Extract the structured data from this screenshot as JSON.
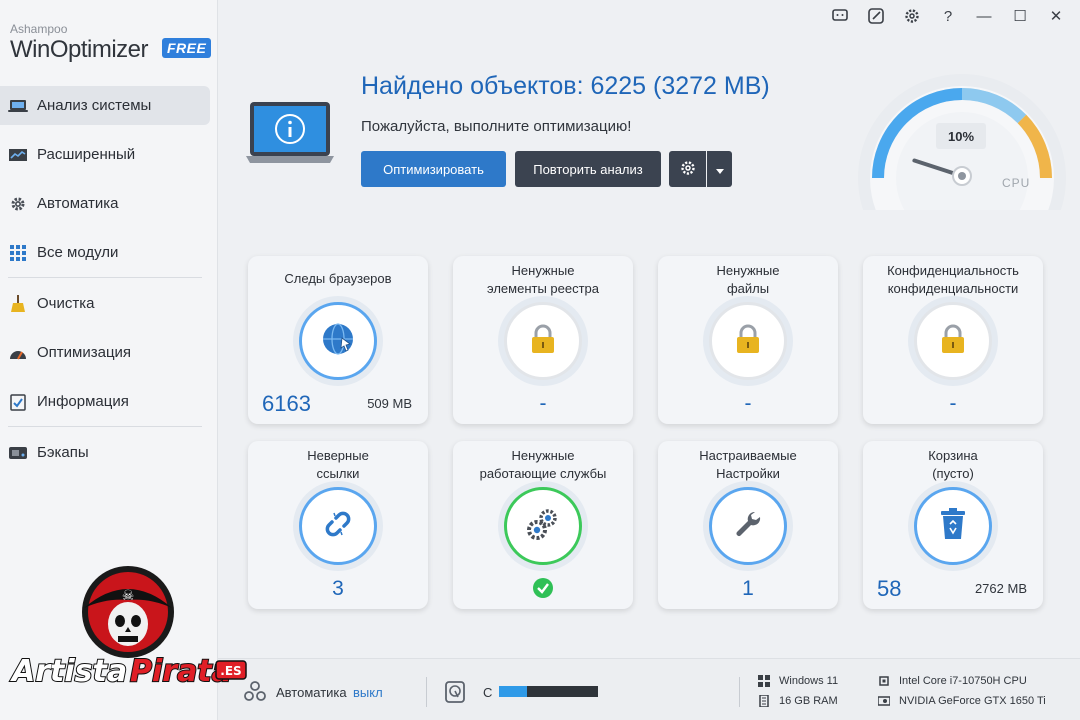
{
  "app": {
    "brand_small": "Ashampoo",
    "brand_name": "WinOptimizer",
    "edition": "FREE"
  },
  "window_controls": [
    "feedback-icon",
    "skin-icon",
    "settings-icon",
    "help-icon",
    "minimize-icon",
    "maximize-icon",
    "close-icon"
  ],
  "window_controls_glyphs": {
    "help": "?",
    "minimize": "—",
    "maximize": "☐",
    "close": "✕"
  },
  "sidebar": {
    "items": [
      {
        "label": "Анализ системы",
        "icon": "laptop-icon",
        "active": true
      },
      {
        "label": "Расширенный",
        "icon": "chart-icon"
      },
      {
        "label": "Автоматика",
        "icon": "cog-icon"
      },
      {
        "label": "Все модули",
        "icon": "grid-icon"
      },
      {
        "label": "Очистка",
        "icon": "broom-icon"
      },
      {
        "label": "Оптимизация",
        "icon": "speedometer-icon"
      },
      {
        "label": "Информация",
        "icon": "checklist-icon"
      },
      {
        "label": "Бэкапы",
        "icon": "drive-icon"
      }
    ]
  },
  "hero": {
    "title": "Найдено объектов: 6225 (3272 MB)",
    "subtitle": "Пожалуйста, выполните оптимизацию!",
    "optimize_label": "Оптимизировать",
    "rescan_label": "Повторить анализ"
  },
  "gauge": {
    "value_percent": 10,
    "value_label": "10%",
    "label": "CPU"
  },
  "cards": [
    {
      "title": [
        "Следы браузеров"
      ],
      "icon": "globe-icon",
      "count": "6163",
      "size": "509 MB"
    },
    {
      "title": [
        "Ненужные",
        "элементы реестра"
      ],
      "icon": "lock-icon",
      "value": "-"
    },
    {
      "title": [
        "Ненужные",
        "файлы"
      ],
      "icon": "lock-icon",
      "value": "-"
    },
    {
      "title": [
        "Конфиденциальность",
        "конфиденциальности"
      ],
      "icon": "lock-icon",
      "value": "-"
    },
    {
      "title": [
        "Неверные",
        "ссылки"
      ],
      "icon": "broken-link-icon",
      "value": "3"
    },
    {
      "title": [
        "Ненужные",
        "работающие службы"
      ],
      "icon": "gears-icon",
      "value": "check"
    },
    {
      "title": [
        "Настраиваемые",
        "Настройки"
      ],
      "icon": "wrench-icon",
      "value": "1"
    },
    {
      "title": [
        "Корзина",
        "(пусто)"
      ],
      "icon": "recycle-bin-icon",
      "count": "58",
      "size": "2762 MB"
    }
  ],
  "status_bar": {
    "automation_label": "Автоматика",
    "automation_value": "выкл",
    "drive_label": "C",
    "drive_fill_fraction": 0.28,
    "os": "Windows 11",
    "ram": "16 GB RAM",
    "cpu": "Intel Core i7-10750H CPU",
    "gpu": "NVIDIA GeForce GTX 1650 Ti"
  },
  "watermark": {
    "text_a": "Artista",
    "text_b": "Pirata",
    "suffix": ".ES"
  },
  "colors": {
    "accent": "#2e79c9",
    "dark_button": "#3b4350",
    "title_blue": "#1f66b8",
    "ring_blue": "#5aa6ef",
    "ring_green": "#3cc95a",
    "lock_gold": "#e8b420"
  }
}
